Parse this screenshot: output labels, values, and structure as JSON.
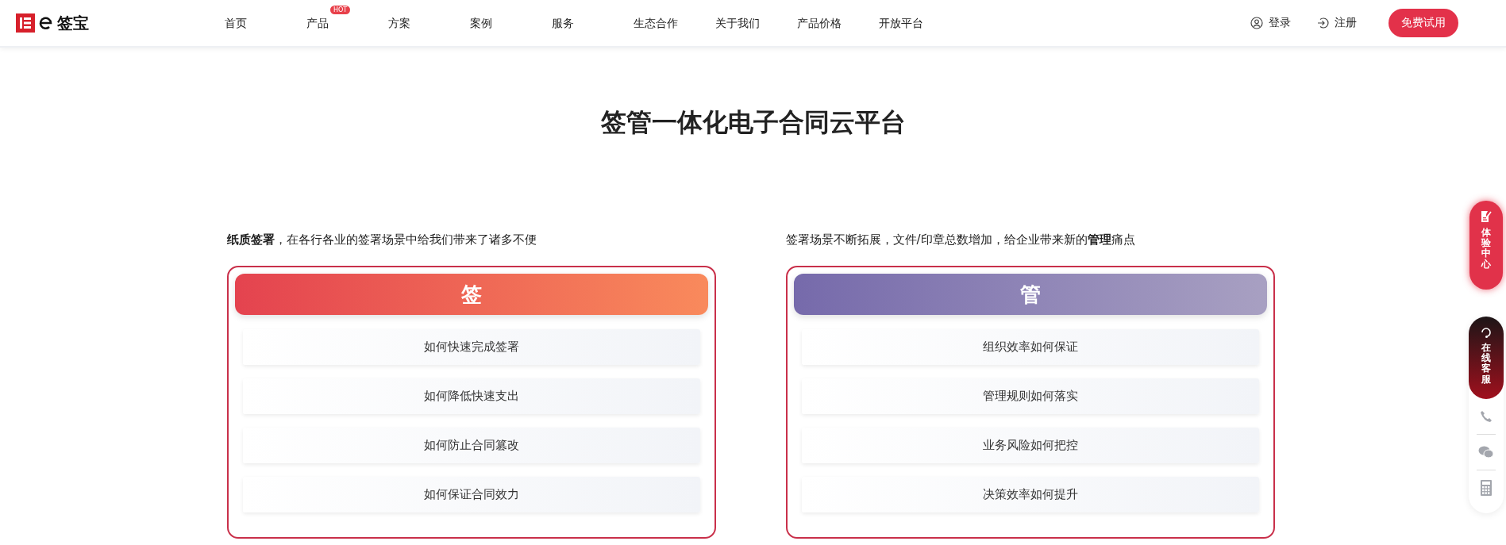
{
  "header": {
    "logo_text": "签宝",
    "nav": [
      {
        "label": "首页"
      },
      {
        "label": "产品",
        "badge": "HOT"
      },
      {
        "label": "方案"
      },
      {
        "label": "案例"
      },
      {
        "label": "服务"
      },
      {
        "label": "生态合作"
      },
      {
        "label": "关于我们"
      },
      {
        "label": "产品价格"
      },
      {
        "label": "开放平台"
      }
    ],
    "login": "登录",
    "register": "注册",
    "cta": "免费试用"
  },
  "title": "签管一体化电子合同云平台",
  "columns": [
    {
      "kind": "sign",
      "intro": "**纸质签署**，在各行各业的签署场景中给我们带来了诸多不便",
      "heading": "签",
      "items": [
        "如何快速完成签署",
        "如何降低快速支出",
        "如何防止合同篡改",
        "如何保证合同效力"
      ]
    },
    {
      "kind": "manage",
      "intro": "签署场景不断拓展，文件/印章总数增加，给企业带来新的**管理**痛点",
      "heading": "管",
      "items": [
        "组织效率如何保证",
        "管理规则如何落实",
        "业务风险如何把控",
        "决策效率如何提升"
      ]
    }
  ],
  "sidebar": {
    "experience": "体验中心",
    "service": "在线客服"
  }
}
